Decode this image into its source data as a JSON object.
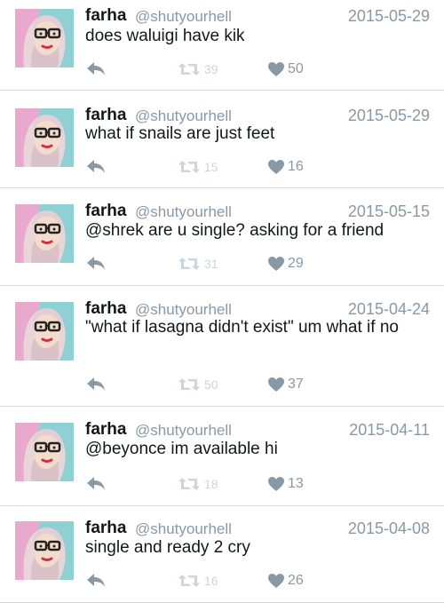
{
  "colors": {
    "text": "#14171a",
    "secondary": "#8899a6",
    "retweet_disabled": "#ccd6dd",
    "divider": "#d6d9dc",
    "avatar_bg": "#8fd0d4"
  },
  "icons": {
    "reply": "reply-arrow-icon",
    "retweet": "retweet-icon",
    "like": "heart-icon"
  },
  "tweets": [
    {
      "name": "farha",
      "handle": "@shutyourhell",
      "date": "2015-05-29",
      "text": "does waluigi have kik",
      "retweets": "39",
      "likes": "50"
    },
    {
      "name": "farha",
      "handle": "@shutyourhell",
      "date": "2015-05-29",
      "text": "what if snails are just feet",
      "retweets": "15",
      "likes": "16"
    },
    {
      "name": "farha",
      "handle": "@shutyourhell",
      "date": "2015-05-15",
      "text": "@shrek are u single? asking for a friend",
      "retweets": "31",
      "likes": "29"
    },
    {
      "name": "farha",
      "handle": "@shutyourhell",
      "date": "2015-04-24",
      "text": "\"what if lasagna didn't exist\" um what if no",
      "retweets": "50",
      "likes": "37"
    },
    {
      "name": "farha",
      "handle": "@shutyourhell",
      "date": "2015-04-11",
      "text": "@beyonce im available hi",
      "retweets": "18",
      "likes": "13"
    },
    {
      "name": "farha",
      "handle": "@shutyourhell",
      "date": "2015-04-08",
      "text": "single and ready 2 cry",
      "retweets": "16",
      "likes": "26"
    }
  ]
}
